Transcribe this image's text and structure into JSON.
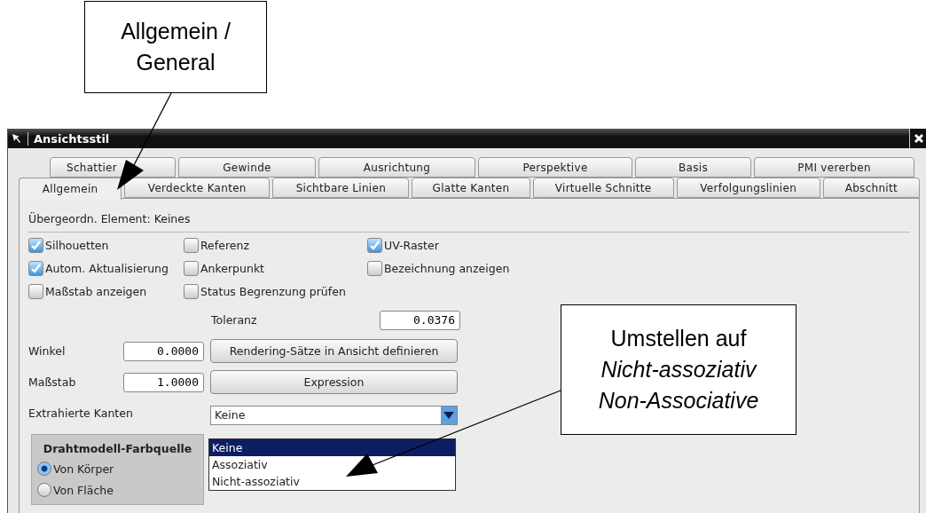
{
  "window": {
    "title": "Ansichtsstil"
  },
  "tab_rows": [
    [
      {
        "label": "Schattier",
        "selected": false
      },
      {
        "label": "Gewinde",
        "selected": false
      },
      {
        "label": "Ausrichtung",
        "selected": false
      },
      {
        "label": "Perspektive",
        "selected": false
      },
      {
        "label": "Basis",
        "selected": false
      },
      {
        "label": "PMI vererben",
        "selected": false
      }
    ],
    [
      {
        "label": "Allgemein",
        "selected": true
      },
      {
        "label": "Verdeckte Kanten",
        "selected": false
      },
      {
        "label": "Sichtbare Linien",
        "selected": false
      },
      {
        "label": "Glatte Kanten",
        "selected": false
      },
      {
        "label": "Virtuelle Schnitte",
        "selected": false
      },
      {
        "label": "Verfolgungslinien",
        "selected": false
      },
      {
        "label": "Abschnitt",
        "selected": false
      }
    ]
  ],
  "parent_element": "Übergeordn. Element: Keines",
  "checkboxes": [
    {
      "label": "Silhouetten",
      "checked": true
    },
    {
      "label": "Referenz",
      "checked": false
    },
    {
      "label": "UV-Raster",
      "checked": true
    },
    {
      "label": "Autom. Aktualisierung",
      "checked": true
    },
    {
      "label": "Ankerpunkt",
      "checked": false
    },
    {
      "label": "Bezeichnung anzeigen",
      "checked": false
    },
    {
      "label": "Maßstab anzeigen",
      "checked": false
    },
    {
      "label": "Status Begrenzung prüfen",
      "checked": false
    }
  ],
  "tolerance": {
    "label": "Toleranz",
    "value": "0.0376"
  },
  "angle": {
    "label": "Winkel",
    "value": "0.0000",
    "button": "Rendering-Sätze in Ansicht definieren"
  },
  "scale": {
    "label": "Maßstab",
    "value": "1.0000",
    "button": "Expression"
  },
  "extracted_edges": {
    "label": "Extrahierte Kanten",
    "value": "Keine",
    "options": [
      {
        "label": "Keine",
        "selected": true
      },
      {
        "label": "Assoziativ",
        "selected": false
      },
      {
        "label": "Nicht-assoziativ",
        "selected": false
      }
    ]
  },
  "wireframe_color_source": {
    "title": "Drahtmodell-Farbquelle",
    "options": [
      {
        "label": "Von Körper",
        "selected": true
      },
      {
        "label": "Von Fläche",
        "selected": false
      }
    ]
  },
  "annotations": [
    {
      "lines": [
        {
          "text": "Allgemein /",
          "italic": false
        },
        {
          "text": "General",
          "italic": false
        }
      ]
    },
    {
      "lines": [
        {
          "text": "Umstellen auf",
          "italic": false
        },
        {
          "text": "Nicht-assoziativ",
          "italic": true
        },
        {
          "text": "Non-Associative",
          "italic": true
        }
      ]
    }
  ]
}
